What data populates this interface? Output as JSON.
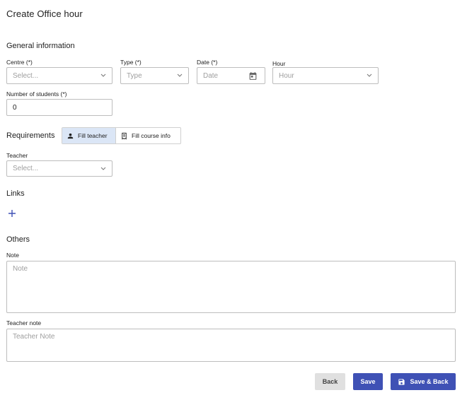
{
  "page": {
    "title": "Create Office hour"
  },
  "general": {
    "section_title": "General information",
    "centre": {
      "label": "Centre (*)",
      "placeholder": "Select..."
    },
    "type": {
      "label": "Type (*)",
      "placeholder": "Type"
    },
    "date": {
      "label": "Date (*)",
      "placeholder": "Date"
    },
    "hour": {
      "label": "Hour",
      "placeholder": "Hour"
    },
    "students": {
      "label": "Number of students (*)",
      "value": "0"
    }
  },
  "requirements": {
    "label": "Requirements",
    "fill_teacher": "Fill teacher",
    "fill_course": "Fill course info",
    "active": "fill_teacher"
  },
  "teacher": {
    "label": "Teacher",
    "placeholder": "Select..."
  },
  "links": {
    "section_title": "Links"
  },
  "others": {
    "section_title": "Others",
    "note": {
      "label": "Note",
      "placeholder": "Note"
    },
    "teacher_note": {
      "label": "Teacher note",
      "placeholder": "Teacher Note"
    }
  },
  "actions": {
    "back": "Back",
    "save": "Save",
    "save_back": "Save & Back"
  },
  "colors": {
    "primary": "#3f51b5",
    "active_toggle": "#dbe6f6",
    "border": "#bdbdbd"
  }
}
